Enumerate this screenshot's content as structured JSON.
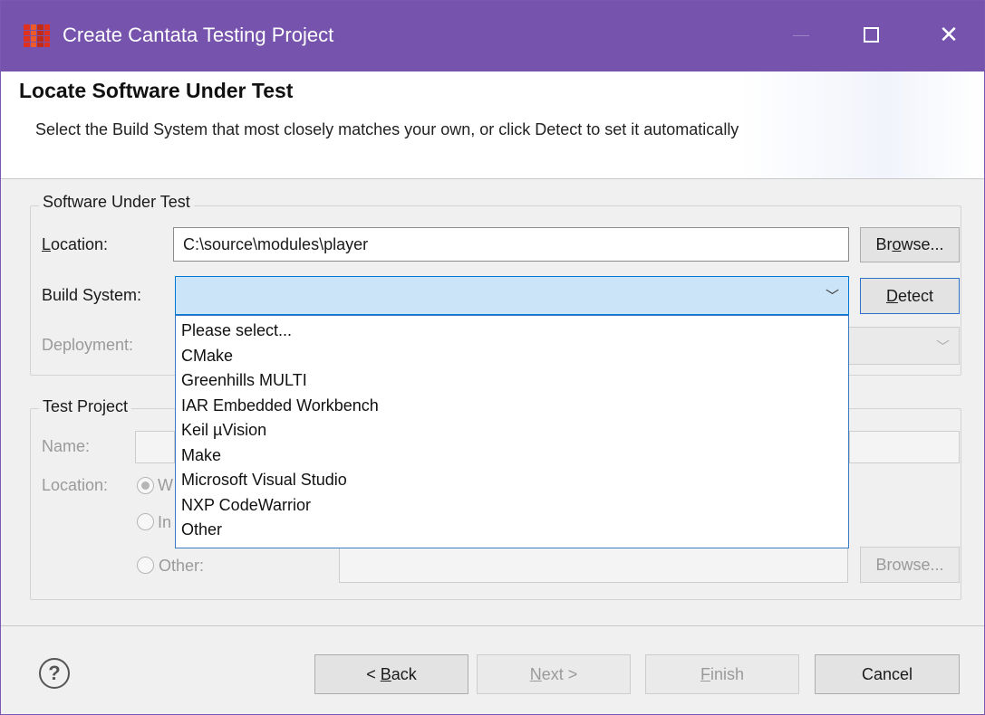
{
  "window": {
    "title": "Create Cantata Testing Project",
    "minimize_icon": "minimize-icon",
    "maximize_icon": "maximize-icon",
    "close_icon": "close-icon",
    "close_glyph": "✕"
  },
  "header": {
    "title": "Locate Software Under Test",
    "description": "Select the Build System that most closely matches your own, or click Detect to set it automatically"
  },
  "software_under_test": {
    "legend": "Software Under Test",
    "location_label": "Location:",
    "location_value": "C:\\source\\modules\\player",
    "browse_label": "Browse...",
    "build_system_label": "Build System:",
    "build_system_value": "",
    "detect_label": "Detect",
    "deployment_label": "Deployment:",
    "chevron_glyph": "﹀"
  },
  "build_system_dropdown": {
    "options": [
      "Please select...",
      "CMake",
      "Greenhills MULTI",
      "IAR Embedded Workbench",
      "Keil µVision",
      "Make",
      "Microsoft Visual Studio",
      "NXP CodeWarrior",
      "Other"
    ]
  },
  "test_project": {
    "legend": "Test Project",
    "name_label": "Name:",
    "location_label": "Location:",
    "option1_partial": "W",
    "option2_partial": "In",
    "other_label": "Other:",
    "browse_label": "Browse..."
  },
  "footer": {
    "help_glyph": "?",
    "back_label": "< Back",
    "next_label": "Next >",
    "finish_label": "Finish",
    "cancel_label": "Cancel"
  },
  "colors": {
    "titlebar": "#7653ad",
    "combo_focus": "#0078d7",
    "combo_fill": "#cce4f7",
    "disabled_text": "#9a9a9a"
  }
}
